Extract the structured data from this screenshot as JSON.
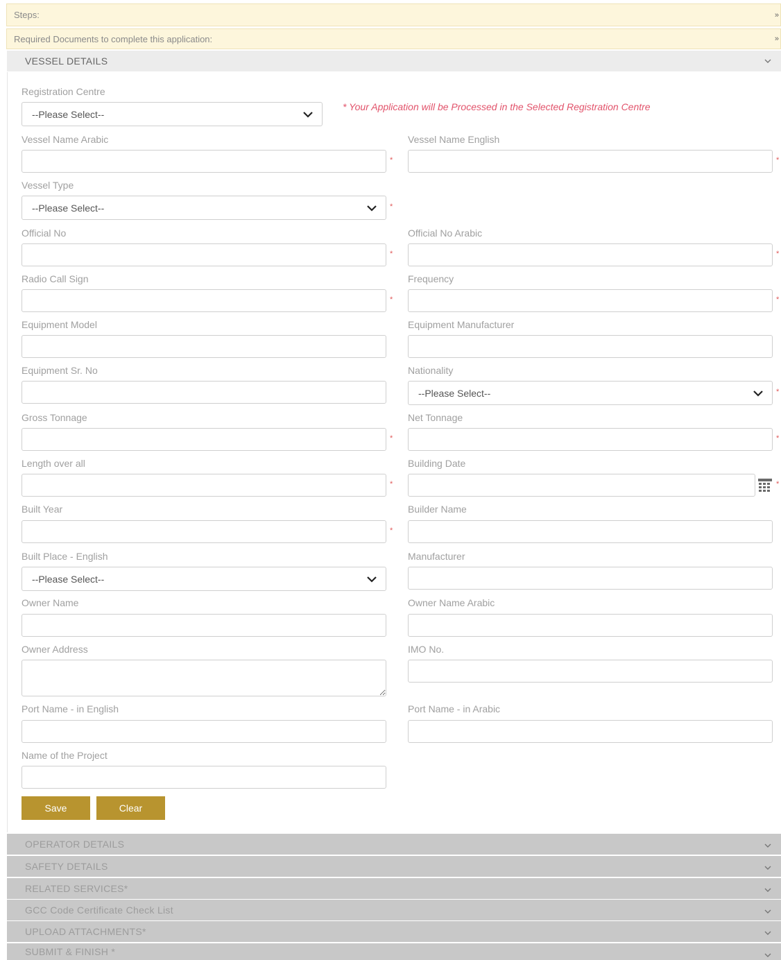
{
  "top_bars": {
    "steps": "Steps:",
    "required_docs": "Required Documents to complete this application:"
  },
  "vessel_section": {
    "title": "VESSEL DETAILS",
    "registration_centre_label": "Registration Centre",
    "registration_centre_value": "--Please Select--",
    "registration_note": "* Your Application will be Processed in the Selected Registration Centre",
    "vessel_name_arabic_label": "Vessel Name Arabic",
    "vessel_name_english_label": "Vessel Name English",
    "vessel_type_label": "Vessel Type",
    "vessel_type_value": "--Please Select--",
    "official_no_label": "Official No",
    "official_no_arabic_label": "Official No Arabic",
    "radio_call_sign_label": "Radio Call Sign",
    "frequency_label": "Frequency",
    "equipment_model_label": "Equipment Model",
    "equipment_manufacturer_label": "Equipment Manufacturer",
    "equipment_sr_no_label": "Equipment Sr. No",
    "nationality_label": "Nationality",
    "nationality_value": "--Please Select--",
    "gross_tonnage_label": "Gross Tonnage",
    "net_tonnage_label": "Net Tonnage",
    "length_over_all_label": "Length over all",
    "building_date_label": "Building Date",
    "built_year_label": "Built Year",
    "builder_name_label": "Builder Name",
    "built_place_label": "Built Place - English",
    "built_place_value": "--Please Select--",
    "manufacturer_label": "Manufacturer",
    "owner_name_label": "Owner Name",
    "owner_name_arabic_label": "Owner Name Arabic",
    "owner_address_label": "Owner Address",
    "imo_no_label": "IMO No.",
    "port_name_english_label": "Port Name - in English",
    "port_name_arabic_label": "Port Name - in Arabic",
    "project_name_label": "Name of the Project",
    "required_mark": "*",
    "save_label": "Save",
    "clear_label": "Clear"
  },
  "collapsed_sections": [
    "OPERATOR DETAILS",
    "SAFETY DETAILS",
    "RELATED SERVICES*",
    "GCC Code Certificate Check List",
    "UPLOAD ATTACHMENTS*",
    "SUBMIT & FINISH *"
  ],
  "colors": {
    "accent": "#b8942f",
    "required": "#e05a5a",
    "note": "#e2536b",
    "banner_bg": "#fdf6dc",
    "section_bg": "#ececec",
    "collapsed_bg": "#c8c8c8"
  },
  "icons": {
    "section_toggle": "chevron-down-icon",
    "select_caret": "chevron-down-icon",
    "date_picker": "calendar-icon",
    "bar_arrow": "double-chevron-icon"
  }
}
